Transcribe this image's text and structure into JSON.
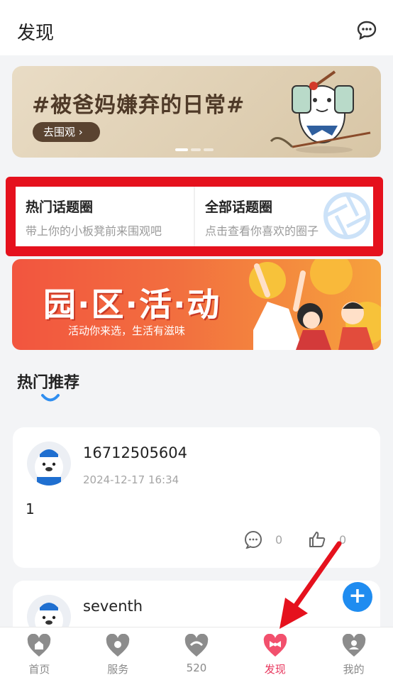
{
  "header": {
    "title": "发现",
    "message_icon": "chat-bubble-icon"
  },
  "banner_top": {
    "title": "#被爸妈嫌弃的日常#",
    "button_label": "去围观 ›",
    "page_count": 3,
    "active_page": 1
  },
  "topics": [
    {
      "title": "热门话题圈",
      "subtitle": "带上你的小板凳前来围观吧"
    },
    {
      "title": "全部话题圈",
      "subtitle": "点击查看你喜欢的圈子"
    }
  ],
  "banner_activity": {
    "title": "园·区·活·动",
    "subtitle": "活动你来选，生活有滋味"
  },
  "section": {
    "title": "热门推荐"
  },
  "posts": [
    {
      "username": "16712505604",
      "timestamp": "2024-12-17 16:34",
      "content": "1",
      "comment_count": "0",
      "like_count": "0"
    },
    {
      "username": "seventh"
    }
  ],
  "fab": {
    "label": "+"
  },
  "tabbar": {
    "items": [
      {
        "label": "首页",
        "icon": "home-heart-icon"
      },
      {
        "label": "服务",
        "icon": "service-heart-icon"
      },
      {
        "label": "520",
        "icon": "hands-heart-icon"
      },
      {
        "label": "发现",
        "icon": "bow-heart-icon",
        "active": true
      },
      {
        "label": "我的",
        "icon": "profile-heart-icon"
      }
    ]
  },
  "colors": {
    "accent_red": "#e5111d",
    "tab_active": "#e8365d",
    "fab_blue": "#1f8cf0"
  }
}
